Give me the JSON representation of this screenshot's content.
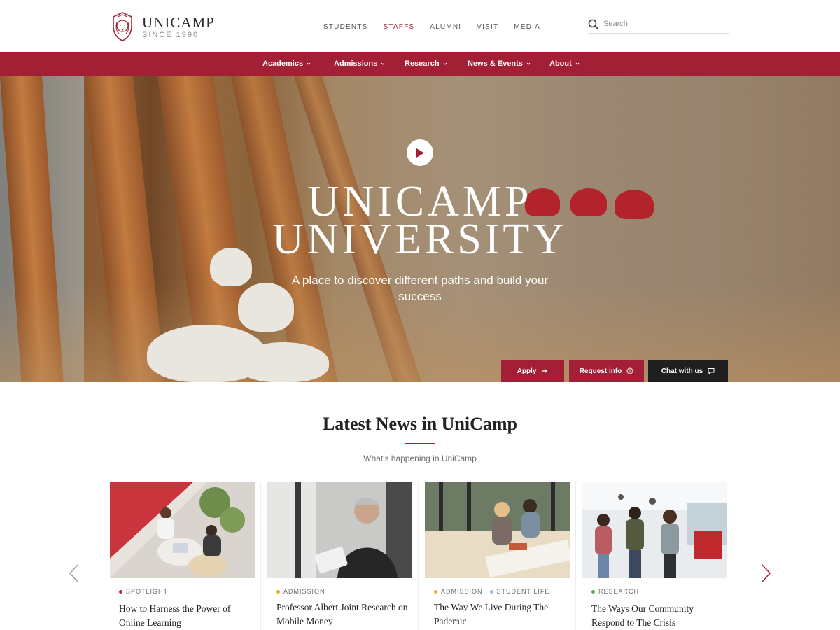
{
  "brand": {
    "name": "UNICAMP",
    "since": "SINCE 1990"
  },
  "top_nav": {
    "items": [
      {
        "label": "STUDENTS",
        "active": false
      },
      {
        "label": "STAFFS",
        "active": true
      },
      {
        "label": "ALUMNI",
        "active": false
      },
      {
        "label": "VISIT",
        "active": false
      },
      {
        "label": "MEDIA",
        "active": false
      }
    ]
  },
  "search": {
    "placeholder": "Search",
    "icon": "search-icon"
  },
  "main_nav": {
    "items": [
      {
        "label": "Academics"
      },
      {
        "label": "Admissions"
      },
      {
        "label": "Research"
      },
      {
        "label": "News & Events"
      },
      {
        "label": "About"
      }
    ]
  },
  "hero": {
    "title_line1": "UNICAMP",
    "title_line2": "UNIVERSITY",
    "subtitle": "A place to discover different paths and build your success",
    "buttons": {
      "apply": "Apply",
      "request": "Request info",
      "chat": "Chat with us"
    }
  },
  "news": {
    "title": "Latest News in UniCamp",
    "subtitle": "What's happening in UniCamp",
    "cards": [
      {
        "tags": [
          {
            "label": "SPOTLIGHT",
            "color": "#c8202f"
          }
        ],
        "title": "How to Harness the Power of Online Learning"
      },
      {
        "tags": [
          {
            "label": "ADMISSION",
            "color": "#e0b225"
          }
        ],
        "title": "Professor Albert Joint Research on Mobile Money"
      },
      {
        "tags": [
          {
            "label": "ADMISSION",
            "color": "#e0b225"
          },
          {
            "label": "STUDENT LIFE",
            "color": "#8fb9e6"
          }
        ],
        "title": "The Way We Live During The Pademic"
      },
      {
        "tags": [
          {
            "label": "RESEARCH",
            "color": "#5aaa5a"
          }
        ],
        "title": "The Ways Our Community Respond to The Crisis"
      }
    ]
  },
  "colors": {
    "brand_red": "#a31f36",
    "dark": "#1f1f1f"
  }
}
